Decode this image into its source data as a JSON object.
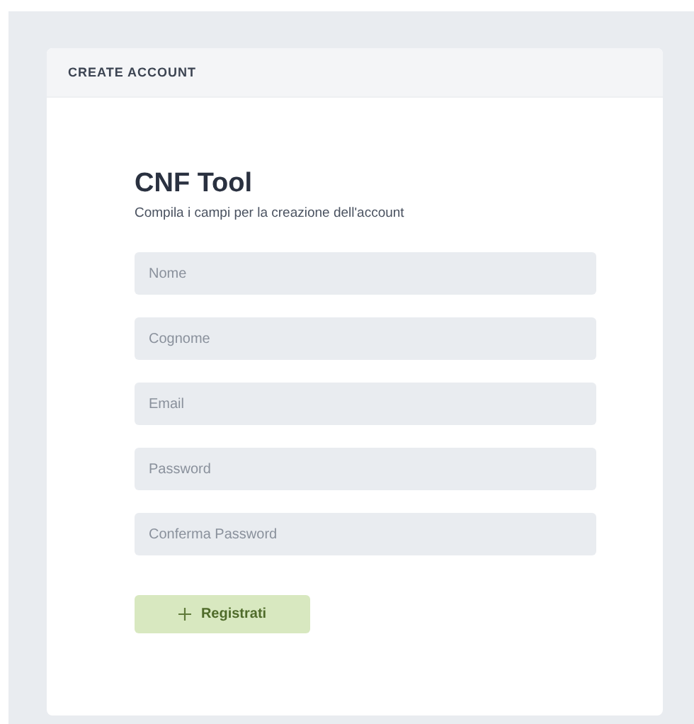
{
  "card": {
    "header": "CREATE ACCOUNT",
    "title": "CNF Tool",
    "subtitle": "Compila i campi per la creazione dell'account",
    "fields": [
      {
        "placeholder": "Nome"
      },
      {
        "placeholder": "Cognome"
      },
      {
        "placeholder": "Email"
      },
      {
        "placeholder": "Password"
      },
      {
        "placeholder": "Conferma Password"
      }
    ],
    "button": {
      "label": "Registrati"
    }
  }
}
